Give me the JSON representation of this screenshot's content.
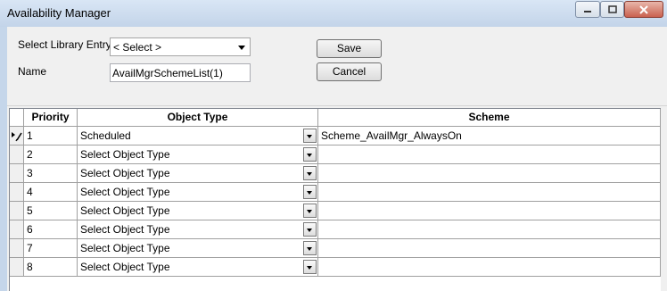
{
  "window": {
    "title": "Availability Manager"
  },
  "form": {
    "library_label": "Select Library Entry",
    "library_value": "< Select >",
    "name_label": "Name",
    "name_value": "AvailMgrSchemeList(1)",
    "save_label": "Save",
    "cancel_label": "Cancel"
  },
  "grid": {
    "columns": [
      "Priority",
      "Object Type",
      "Scheme"
    ],
    "rows": [
      {
        "priority": "1",
        "object_type": "Scheduled",
        "scheme": "Scheme_AvailMgr_AlwaysOn"
      },
      {
        "priority": "2",
        "object_type": "Select Object Type",
        "scheme": ""
      },
      {
        "priority": "3",
        "object_type": "Select Object Type",
        "scheme": ""
      },
      {
        "priority": "4",
        "object_type": "Select Object Type",
        "scheme": ""
      },
      {
        "priority": "5",
        "object_type": "Select Object Type",
        "scheme": ""
      },
      {
        "priority": "6",
        "object_type": "Select Object Type",
        "scheme": ""
      },
      {
        "priority": "7",
        "object_type": "Select Object Type",
        "scheme": ""
      },
      {
        "priority": "8",
        "object_type": "Select Object Type",
        "scheme": ""
      }
    ]
  }
}
